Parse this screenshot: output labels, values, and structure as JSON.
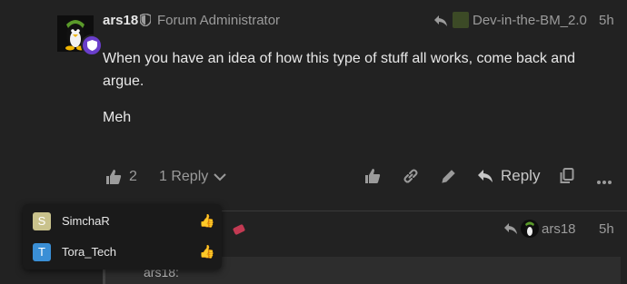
{
  "post": {
    "username": "ars18",
    "user_title": "Forum Administrator",
    "reply_to_name": "Dev-in-the-BM_2.0",
    "date": "5h",
    "paragraphs": [
      "When you have an idea of how this type of stuff all works, come back and argue.",
      "Meh"
    ],
    "like_count": "2",
    "replies_label": "1 Reply",
    "reply_label": "Reply"
  },
  "next_post": {
    "reply_to_name": "ars18",
    "date": "5h",
    "quote_text": "ars18:"
  },
  "likers_popup": {
    "users": [
      {
        "initial": "S",
        "name": "SimchaR",
        "avatar_color": "#c9c28c",
        "emoji": "👍"
      },
      {
        "initial": "T",
        "name": "Tora_Tech",
        "avatar_color": "#3a8fd6",
        "emoji": "👍"
      }
    ]
  },
  "colors": {
    "background": "#222222",
    "admin_badge": "#6a3ecb",
    "muted_text": "#9b9b9b"
  }
}
